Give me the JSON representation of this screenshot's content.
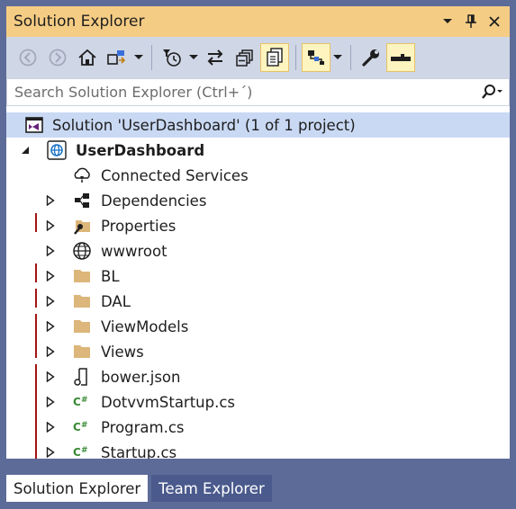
{
  "window": {
    "title": "Solution Explorer",
    "title_buttons": [
      "dropdown",
      "pin",
      "close"
    ]
  },
  "toolbar": {
    "icons": [
      "back-icon",
      "forward-icon",
      "home-icon",
      "switch-views-icon",
      "pending-changes-filter-icon",
      "sync-icon",
      "collapse-all-icon",
      "show-all-files-icon",
      "preview-icon",
      "properties-icon",
      "preview-selected-icon"
    ]
  },
  "search": {
    "placeholder": "Search Solution Explorer (Ctrl+´)"
  },
  "tree": {
    "solution_label": "Solution 'UserDashboard' (1 of 1 project)",
    "project_label": "UserDashboard",
    "items": [
      {
        "label": "Connected Services",
        "icon": "connected-services-icon"
      },
      {
        "label": "Dependencies",
        "icon": "dependencies-icon"
      },
      {
        "label": "Properties",
        "icon": "properties-folder-icon"
      },
      {
        "label": "wwwroot",
        "icon": "globe-icon"
      },
      {
        "label": "BL",
        "icon": "folder-icon"
      },
      {
        "label": "DAL",
        "icon": "folder-icon"
      },
      {
        "label": "ViewModels",
        "icon": "folder-icon"
      },
      {
        "label": "Views",
        "icon": "folder-icon"
      },
      {
        "label": "bower.json",
        "icon": "json-file-icon"
      },
      {
        "label": "DotvvmStartup.cs",
        "icon": "csharp-file-icon"
      },
      {
        "label": "Program.cs",
        "icon": "csharp-file-icon"
      },
      {
        "label": "Startup.cs",
        "icon": "csharp-file-icon"
      }
    ]
  },
  "tabs": {
    "solution_explorer": "Solution Explorer",
    "team_explorer": "Team Explorer"
  },
  "colors": {
    "chrome": "#5d6b99",
    "titlebar": "#f5cc84",
    "toolbar": "#cfd6e5",
    "selection": "#c9d9f4",
    "folder": "#dcb67a",
    "csharp": "#388a34",
    "change_gutter": "#a31515"
  }
}
